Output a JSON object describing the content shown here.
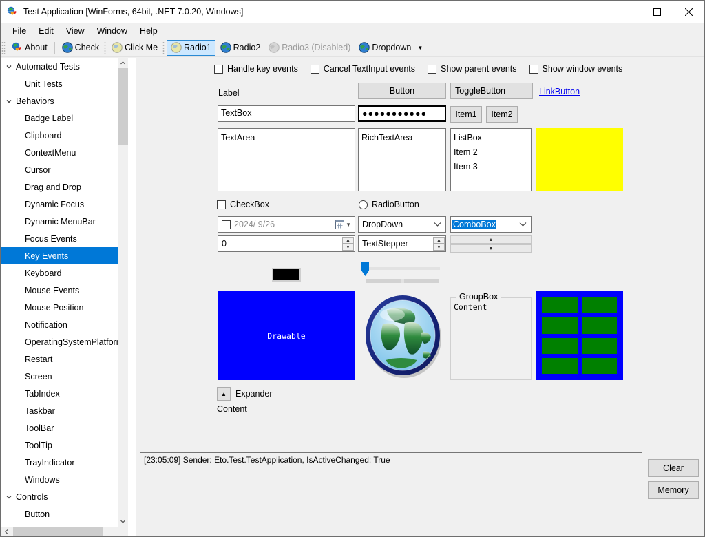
{
  "window": {
    "title": "Test Application [WinForms, 64bit, .NET 7.0.20, Windows]",
    "app_icon": "heart-globe-icon",
    "minimize": "minimize-icon",
    "maximize": "maximize-icon",
    "close": "close-icon"
  },
  "menubar": {
    "items": [
      {
        "label": "File"
      },
      {
        "label": "Edit"
      },
      {
        "label": "View"
      },
      {
        "label": "Window"
      },
      {
        "label": "Help"
      }
    ]
  },
  "toolbar": {
    "items": [
      {
        "label": "About",
        "icon": "heart-globe-icon",
        "state": "normal"
      },
      {
        "label": "Check",
        "icon": "globe-icon",
        "state": "normal"
      },
      {
        "label": "Click Me",
        "icon": "pale-globe-icon",
        "state": "normal"
      },
      {
        "label": "Radio1",
        "icon": "pale-globe-icon",
        "state": "selected"
      },
      {
        "label": "Radio2",
        "icon": "globe-icon",
        "state": "normal"
      },
      {
        "label": "Radio3 (Disabled)",
        "icon": "gray-globe-icon",
        "state": "disabled"
      },
      {
        "label": "Dropdown",
        "icon": "globe-icon",
        "state": "dropdown"
      }
    ]
  },
  "sidebar": {
    "nodes": [
      {
        "label": "Automated Tests",
        "level": "group",
        "expanded": true,
        "selected": false
      },
      {
        "label": "Unit Tests",
        "level": "child",
        "selected": false
      },
      {
        "label": "Behaviors",
        "level": "group",
        "expanded": true,
        "selected": false
      },
      {
        "label": "Badge Label",
        "level": "child",
        "selected": false
      },
      {
        "label": "Clipboard",
        "level": "child",
        "selected": false
      },
      {
        "label": "ContextMenu",
        "level": "child",
        "selected": false
      },
      {
        "label": "Cursor",
        "level": "child",
        "selected": false
      },
      {
        "label": "Drag and Drop",
        "level": "child",
        "selected": false
      },
      {
        "label": "Dynamic Focus",
        "level": "child",
        "selected": false
      },
      {
        "label": "Dynamic MenuBar",
        "level": "child",
        "selected": false
      },
      {
        "label": "Focus Events",
        "level": "child",
        "selected": false
      },
      {
        "label": "Key Events",
        "level": "child",
        "selected": true
      },
      {
        "label": "Keyboard",
        "level": "child",
        "selected": false
      },
      {
        "label": "Mouse Events",
        "level": "child",
        "selected": false
      },
      {
        "label": "Mouse Position",
        "level": "child",
        "selected": false
      },
      {
        "label": "Notification",
        "level": "child",
        "selected": false
      },
      {
        "label": "OperatingSystemPlatform",
        "level": "child",
        "selected": false
      },
      {
        "label": "Restart",
        "level": "child",
        "selected": false
      },
      {
        "label": "Screen",
        "level": "child",
        "selected": false
      },
      {
        "label": "TabIndex",
        "level": "child",
        "selected": false
      },
      {
        "label": "Taskbar",
        "level": "child",
        "selected": false
      },
      {
        "label": "ToolBar",
        "level": "child",
        "selected": false
      },
      {
        "label": "ToolTip",
        "level": "child",
        "selected": false
      },
      {
        "label": "TrayIndicator",
        "level": "child",
        "selected": false
      },
      {
        "label": "Windows",
        "level": "child",
        "selected": false
      },
      {
        "label": "Controls",
        "level": "group",
        "expanded": true,
        "selected": false
      },
      {
        "label": "Button",
        "level": "child",
        "selected": false
      }
    ]
  },
  "main": {
    "options": [
      {
        "label": "Handle key events",
        "checked": false
      },
      {
        "label": "Cancel TextInput events",
        "checked": false
      },
      {
        "label": "Show parent events",
        "checked": false
      },
      {
        "label": "Show window events",
        "checked": false
      }
    ],
    "label_text": "Label",
    "button_label": "Button",
    "toggle_button_label": "ToggleButton",
    "link_button_label": "LinkButton",
    "textbox_value": "TextBox",
    "password_value": "●●●●●●●●●●●",
    "segment_item1": "Item1",
    "segment_item2": "Item2",
    "textarea_value": "TextArea",
    "richtextarea_value": "RichTextArea",
    "listbox_items": [
      "ListBox",
      "Item 2",
      "Item 3"
    ],
    "yellow_panel_color": "#ffff00",
    "checkbox_label": "CheckBox",
    "radiobutton_label": "RadioButton",
    "datepicker_value": "2024/  9/26",
    "datepicker_checked": false,
    "dropdown_value": "DropDown",
    "combobox_value": "ComboBox",
    "numeric_value": "0",
    "textstepper_value": "TextStepper",
    "spinner_up": "▲",
    "spinner_down": "▼",
    "color_value": "#000000",
    "drawable_label": "Drawable",
    "image_icon": "globe-image",
    "groupbox_title": "GroupBox",
    "groupbox_content": "Content",
    "grid_panel_color": "#0000ff",
    "grid_cell_color": "#008000",
    "grid_cell_count": 8,
    "expander_label": "Expander",
    "expander_content": "Content",
    "expander_glyph": "▲"
  },
  "log": {
    "lines": [
      "[23:05:09] Sender: Eto.Test.TestApplication, IsActiveChanged: True"
    ],
    "clear_label": "Clear",
    "memory_label": "Memory"
  },
  "colors": {
    "accent": "#0078d7",
    "selected_toolbar_bg": "#cde8ff",
    "chrome": "#f0f0f0"
  }
}
